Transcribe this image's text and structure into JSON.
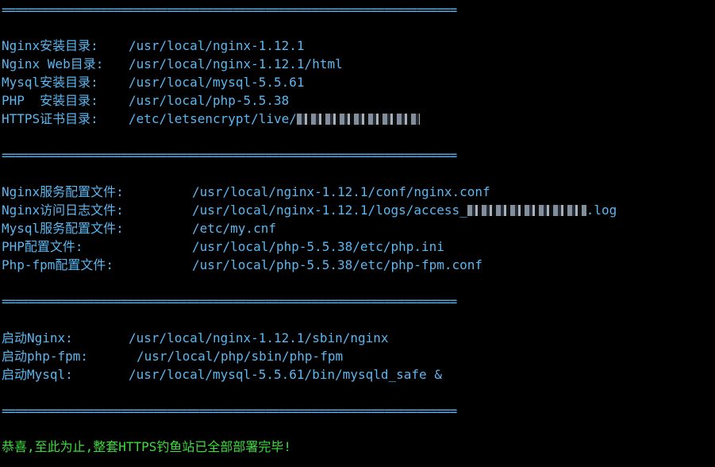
{
  "theme": {
    "text_color": "#5cb6f0",
    "success_color": "#3cdc3c",
    "background": "#000000"
  },
  "separator": "=====================================================================",
  "section1": [
    {
      "label": "Nginx安装目录:",
      "value": "/usr/local/nginx-1.12.1"
    },
    {
      "label": "Nginx Web目录:",
      "value": "/usr/local/nginx-1.12.1/html"
    },
    {
      "label": "Mysql安装目录:",
      "value": "/usr/local/mysql-5.5.61"
    },
    {
      "label": "PHP  安装目录:",
      "value": "/usr/local/php-5.5.38"
    },
    {
      "label": "HTTPS证书目录:",
      "value": "/etc/letsencrypt/live/"
    }
  ],
  "section2": [
    {
      "label": "Nginx服务配置文件:",
      "value": "/usr/local/nginx-1.12.1/conf/nginx.conf"
    },
    {
      "label": "Nginx访问日志文件:",
      "value": "/usr/local/nginx-1.12.1/logs/access_",
      "value_suffix": ".log"
    },
    {
      "label": "Mysql服务配置文件:",
      "value": "/etc/my.cnf"
    },
    {
      "label": "PHP配置文件:",
      "value": "/usr/local/php-5.5.38/etc/php.ini"
    },
    {
      "label": "Php-fpm配置文件:",
      "value": "/usr/local/php-5.5.38/etc/php-fpm.conf"
    }
  ],
  "section3": [
    {
      "label": "启动Nginx:",
      "value": "/usr/local/nginx-1.12.1/sbin/nginx"
    },
    {
      "label": "启动php-fpm:",
      "value": "/usr/local/php/sbin/php-fpm"
    },
    {
      "label": "启动Mysql:",
      "value": "/usr/local/mysql-5.5.61/bin/mysqld_safe &"
    }
  ],
  "final_message": "恭喜,至此为止,整套HTTPS钓鱼站已全部部署完毕!"
}
